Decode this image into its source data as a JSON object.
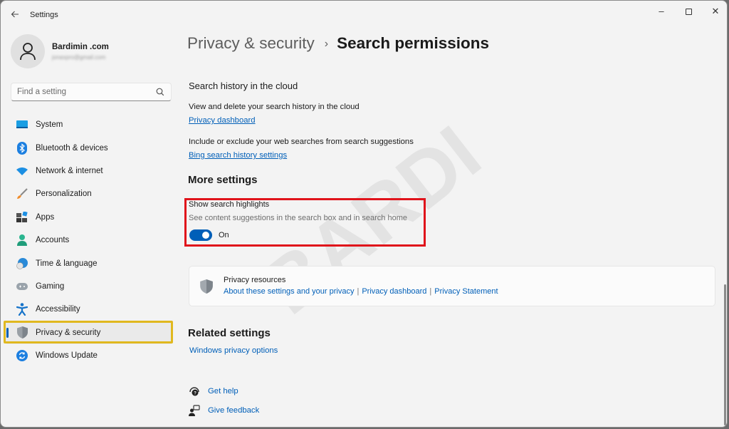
{
  "window": {
    "app_title": "Settings",
    "back_icon": "arrow-left-icon",
    "controls": {
      "minimize": "–",
      "close": "✕"
    }
  },
  "profile": {
    "name": "Bardimin .com",
    "email": "jonaxpro@gmail.com"
  },
  "search": {
    "placeholder": "Find a setting",
    "value": ""
  },
  "sidebar": {
    "items": [
      {
        "label": "System",
        "icon": "monitor-icon"
      },
      {
        "label": "Bluetooth & devices",
        "icon": "bluetooth-icon"
      },
      {
        "label": "Network & internet",
        "icon": "wifi-icon"
      },
      {
        "label": "Personalization",
        "icon": "paintbrush-icon"
      },
      {
        "label": "Apps",
        "icon": "apps-icon"
      },
      {
        "label": "Accounts",
        "icon": "person-icon"
      },
      {
        "label": "Time & language",
        "icon": "globe-clock-icon"
      },
      {
        "label": "Gaming",
        "icon": "gamepad-icon"
      },
      {
        "label": "Accessibility",
        "icon": "accessibility-icon"
      },
      {
        "label": "Privacy & security",
        "icon": "shield-icon",
        "active": true
      },
      {
        "label": "Windows Update",
        "icon": "refresh-icon"
      }
    ]
  },
  "breadcrumb": {
    "parent": "Privacy & security",
    "separator": "›",
    "current": "Search permissions"
  },
  "cloud_history": {
    "title": "Search history in the cloud",
    "view_desc": "View and delete your search history in the cloud",
    "view_link": "Privacy dashboard",
    "include_desc": "Include or exclude your web searches from search suggestions",
    "include_link": "Bing search history settings"
  },
  "more_settings": {
    "heading": "More settings",
    "highlights": {
      "title": "Show search highlights",
      "description": "See content suggestions in the search box and in search home",
      "toggle_on": true,
      "toggle_label": "On"
    }
  },
  "privacy_resources": {
    "title": "Privacy resources",
    "links": [
      "About these settings and your privacy",
      "Privacy dashboard",
      "Privacy Statement"
    ],
    "separator": "|"
  },
  "related_settings": {
    "heading": "Related settings",
    "link": "Windows privacy options"
  },
  "footer": {
    "get_help": "Get help",
    "give_feedback": "Give feedback"
  },
  "colors": {
    "accent": "#005fb8",
    "annotation_red": "#e0131b",
    "annotation_yellow": "#e0b81f"
  }
}
